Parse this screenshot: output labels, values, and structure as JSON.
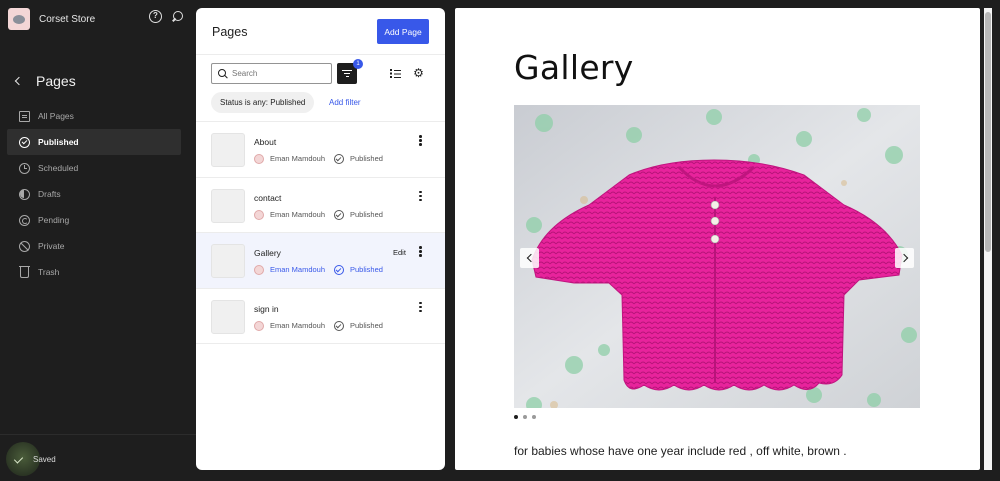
{
  "site": {
    "name": "Corset Store"
  },
  "sidebar": {
    "section_title": "Pages",
    "items": [
      {
        "label": "All Pages",
        "icon": "pages-icon"
      },
      {
        "label": "Published",
        "icon": "published-icon",
        "active": true
      },
      {
        "label": "Scheduled",
        "icon": "scheduled-icon"
      },
      {
        "label": "Drafts",
        "icon": "drafts-icon"
      },
      {
        "label": "Pending",
        "icon": "pending-icon"
      },
      {
        "label": "Private",
        "icon": "private-icon"
      },
      {
        "label": "Trash",
        "icon": "trash-icon"
      }
    ],
    "footer_status": "Saved"
  },
  "list": {
    "title": "Pages",
    "add_button": "Add Page",
    "search_placeholder": "Search",
    "filter_count": "1",
    "status_filter": "Status is any: Published",
    "add_filter": "Add filter",
    "rows": [
      {
        "title": "About",
        "author": "Eman Mamdouh",
        "status": "Published"
      },
      {
        "title": "contact",
        "author": "Eman Mamdouh",
        "status": "Published"
      },
      {
        "title": "Gallery",
        "author": "Eman Mamdouh",
        "status": "Published",
        "edit": "Edit",
        "selected": true
      },
      {
        "title": "sign in",
        "author": "Eman Mamdouh",
        "status": "Published"
      }
    ]
  },
  "preview": {
    "title": "Gallery",
    "caption": "for babies whose have one year include red , off white, brown .",
    "slider_slides": 3,
    "slider_active": 1
  },
  "colors": {
    "accent": "#3858e9",
    "sidebar_bg": "#1e1e1e",
    "sweater_pink": "#e8239c"
  }
}
